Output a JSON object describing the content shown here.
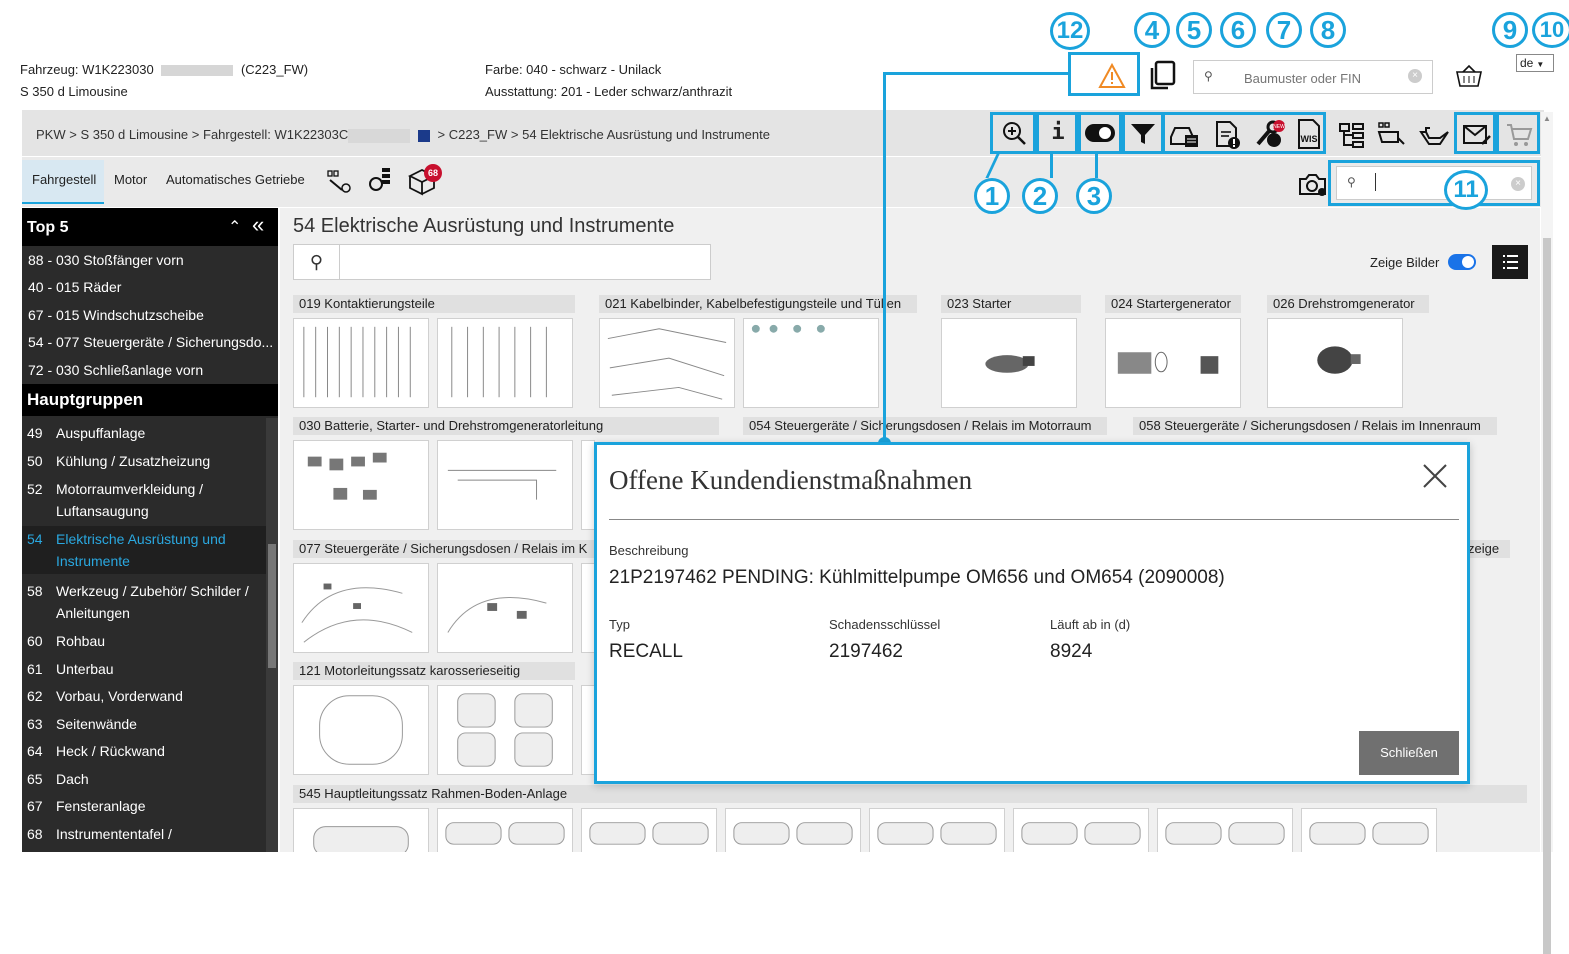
{
  "header": {
    "vehicle_label": "Fahrzeug: W1K223030",
    "vehicle_suffix": "(C223_FW)",
    "model": "S 350 d Limousine",
    "color": "Farbe: 040 - schwarz - Unilack",
    "equipment": "Ausstattung: 201 - Leder schwarz/anthrazit",
    "search_placeholder": "Baumuster oder FIN",
    "language": "de"
  },
  "breadcrumb": {
    "items": [
      "PKW",
      "S 350 d Limousine",
      "Fahrgestell: W1K22303C"
    ],
    "tail": [
      "C223_FW",
      "54 Elektrische Ausrüstung und Instrumente"
    ],
    "sep": ">"
  },
  "tabs": {
    "items": [
      "Fahrgestell",
      "Motor",
      "Automatisches Getriebe"
    ],
    "badge": "68"
  },
  "callouts": [
    "1",
    "2",
    "3",
    "4",
    "5",
    "6",
    "7",
    "8",
    "9",
    "10",
    "11",
    "12"
  ],
  "sidebar": {
    "top5_title": "Top 5",
    "top5": [
      "88 - 030 Stoßfänger vorn",
      "40 - 015 Räder",
      "67 - 015 Windschutzscheibe",
      "54 - 077 Steuergeräte / Sicherungsdo...",
      "72 - 030 Schließanlage vorn"
    ],
    "groups_title": "Hauptgruppen",
    "groups": [
      {
        "num": "49",
        "label": "Auspuffanlage"
      },
      {
        "num": "50",
        "label": "Kühlung / Zusatzheizung"
      },
      {
        "num": "52",
        "label": "Motorraumverkleidung /",
        "label2": "Luftansaugung"
      },
      {
        "num": "54",
        "label": "Elektrische Ausrüstung und",
        "label2": "Instrumente"
      },
      {
        "num": "58",
        "label": "Werkzeug / Zubehör/ Schilder /",
        "label2": "Anleitungen"
      },
      {
        "num": "60",
        "label": "Rohbau"
      },
      {
        "num": "61",
        "label": "Unterbau"
      },
      {
        "num": "62",
        "label": "Vorbau, Vorderwand"
      },
      {
        "num": "63",
        "label": "Seitenwände"
      },
      {
        "num": "64",
        "label": "Heck / Rückwand"
      },
      {
        "num": "65",
        "label": "Dach"
      },
      {
        "num": "67",
        "label": "Fensteranlage"
      },
      {
        "num": "68",
        "label": "Instrumententafel /"
      }
    ]
  },
  "main": {
    "title": "54 Elektrische Ausrüstung und Instrumente",
    "show_images_label": "Zeige Bilder",
    "groups": [
      "019 Kontaktierungsteile",
      "021 Kabelbinder, Kabelbefestigungsteile und Tüllen",
      "023 Starter",
      "024 Startergenerator",
      "026 Drehstromgenerator",
      "030 Batterie, Starter- und Drehstromgeneratorleitung",
      "054 Steuergeräte / Sicherungsdosen / Relais im Motorraum",
      "058 Steuergeräte / Sicherungsdosen / Relais im Innenraum",
      "077 Steuergeräte / Sicherungsdosen / Relais im K",
      "zeige",
      "121 Motorleitungssatz karosserieseitig",
      "545 Hauptleitungssatz Rahmen-Boden-Anlage"
    ]
  },
  "modal": {
    "title": "Offene Kundendienstmaßnahmen",
    "desc_label": "Beschreibung",
    "desc": "21P2197462 PENDING: Kühlmittelpumpe OM656 und OM654 (2090008)",
    "col1_label": "Typ",
    "col1_value": "RECALL",
    "col2_label": "Schadensschlüssel",
    "col2_value": "2197462",
    "col3_label": "Läuft ab in (d)",
    "col3_value": "8924",
    "close_button": "Schließen"
  },
  "colors": {
    "accent": "#1aa3dc",
    "sidebar_bg": "#2b2b2b",
    "sidebar_header_bg": "#000000",
    "active_item": "#2aa8e0",
    "toolbar_bg": "#e4e4e4",
    "warning": "#f08a24",
    "badge": "#c8102e"
  }
}
